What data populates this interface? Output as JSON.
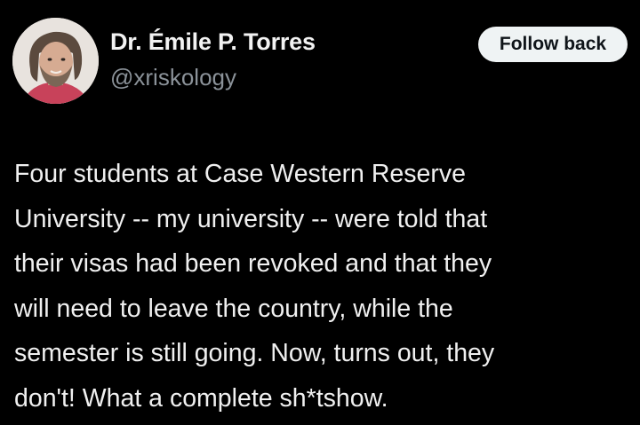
{
  "author": {
    "display_name": "Dr. Émile P. Torres",
    "handle": "@xriskology",
    "avatar_icon": "user-portrait"
  },
  "follow_button": {
    "label": "Follow back"
  },
  "tweet": {
    "lines": [
      "Four students at Case Western Reserve",
      "University -- my university -- were told that",
      "their visas had been revoked and that they",
      "will need to leave the country, while the",
      "semester is still going. Now, turns out, they",
      "don't! What a complete sh*tshow."
    ]
  },
  "colors": {
    "background": "#000000",
    "text": "#e7e9ea",
    "secondary_text": "#8b9299",
    "button_bg": "#eff3f4",
    "button_text": "#0f1419"
  }
}
